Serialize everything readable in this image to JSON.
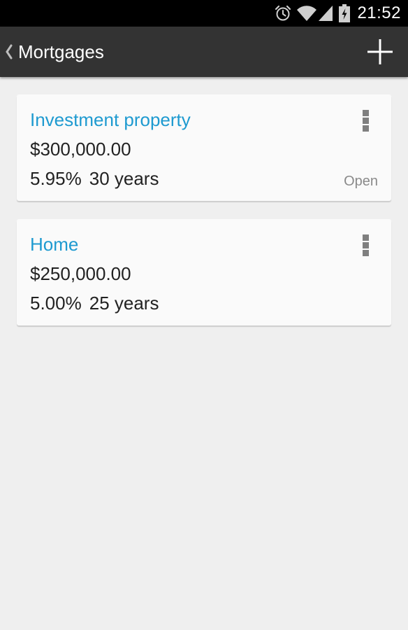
{
  "status_bar": {
    "time": "21:52",
    "icons": [
      "alarm-icon",
      "wifi-icon",
      "cell-signal-icon",
      "battery-charging-icon"
    ]
  },
  "action_bar": {
    "title": "Mortgages",
    "back_icon": "chevron-left-icon",
    "add_icon": "plus-icon"
  },
  "mortgages": [
    {
      "name": "Investment property",
      "amount": "$300,000.00",
      "rate": "5.95%",
      "term": "30 years",
      "status": "Open"
    },
    {
      "name": "Home",
      "amount": "$250,000.00",
      "rate": "5.00%",
      "term": "25 years",
      "status": ""
    }
  ],
  "colors": {
    "status_bar": "#000000",
    "action_bar": "#333333",
    "background": "#efefef",
    "card": "#fafafa",
    "accent": "#1e9ad0"
  }
}
